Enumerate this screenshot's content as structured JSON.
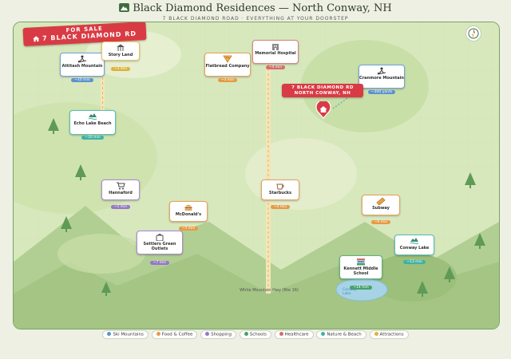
{
  "header": {
    "title": "Black Diamond Residences — North Conway, NH",
    "subtitle": "7 BLACK DIAMOND ROAD · EVERYTHING AT YOUR DOORSTEP"
  },
  "sale_banner": {
    "line1": "FOR SALE",
    "line2": "7 BLACK DIAMOND RD"
  },
  "property": {
    "line1": "7 BLACK DIAMOND RD",
    "line2": "NORTH CONWAY, NH"
  },
  "road": {
    "label": "White Mountain Hwy (Rte 16)"
  },
  "lake": {
    "label_line1": "Conway",
    "label_line2": "Lake"
  },
  "colors": {
    "ski": "#5c93cf",
    "food": "#e69a45",
    "shopping": "#9577c7",
    "schools": "#45a36a",
    "healthcare": "#d36d6d",
    "nature": "#3fb2a4",
    "attractions": "#ddb23e",
    "banner": "#d93b44"
  },
  "places": [
    {
      "id": "attitash",
      "name": "Attitash Mountain",
      "badge": "~10 min",
      "category": "ski",
      "icon": "skier-icon"
    },
    {
      "id": "story-land",
      "name": "Story Land",
      "badge": "~3 min",
      "category": "attr",
      "icon": "carousel-icon"
    },
    {
      "id": "flatbread",
      "name": "Flatbread Company",
      "badge": "~3 min",
      "category": "food",
      "icon": "pizza-icon"
    },
    {
      "id": "memorial",
      "name": "Memorial Hospital",
      "badge": "~4 min",
      "category": "health",
      "icon": "hospital-icon"
    },
    {
      "id": "cranmore",
      "name": "Cranmore Mountain",
      "badge": "~300 yards",
      "category": "ski",
      "icon": "skier-icon"
    },
    {
      "id": "echo-lake",
      "name": "Echo Lake Beach",
      "badge": "~10 min",
      "category": "nature",
      "icon": "lake-icon"
    },
    {
      "id": "hannaford",
      "name": "Hannaford",
      "badge": "~5 min",
      "category": "shop",
      "icon": "cart-icon"
    },
    {
      "id": "starbucks",
      "name": "Starbucks",
      "badge": "~4 min",
      "category": "food",
      "icon": "coffee-icon"
    },
    {
      "id": "subway",
      "name": "Subway",
      "badge": "~6 min",
      "category": "food",
      "icon": "sandwich-icon"
    },
    {
      "id": "mcdonalds",
      "name": "McDonald's",
      "badge": "~5 min",
      "category": "food",
      "icon": "burger-icon"
    },
    {
      "id": "settlers",
      "name": "Settlers Green Outlets",
      "badge": "~7 min",
      "category": "shop",
      "icon": "shopping-bag-icon"
    },
    {
      "id": "conway-lake",
      "name": "Conway Lake",
      "badge": "~13 min",
      "category": "nature",
      "icon": "lake-icon"
    },
    {
      "id": "kennett",
      "name": "Kennett Middle School",
      "badge": "~14 min",
      "category": "school",
      "icon": "books-icon"
    }
  ],
  "legend": [
    {
      "label": "Ski Mountains",
      "color": "#5c93cf"
    },
    {
      "label": "Food & Coffee",
      "color": "#e69a45"
    },
    {
      "label": "Shopping",
      "color": "#9577c7"
    },
    {
      "label": "Schools",
      "color": "#45a36a"
    },
    {
      "label": "Healthcare",
      "color": "#d36d6d"
    },
    {
      "label": "Nature & Beach",
      "color": "#3fb2a4"
    },
    {
      "label": "Attractions",
      "color": "#ddb23e"
    }
  ]
}
